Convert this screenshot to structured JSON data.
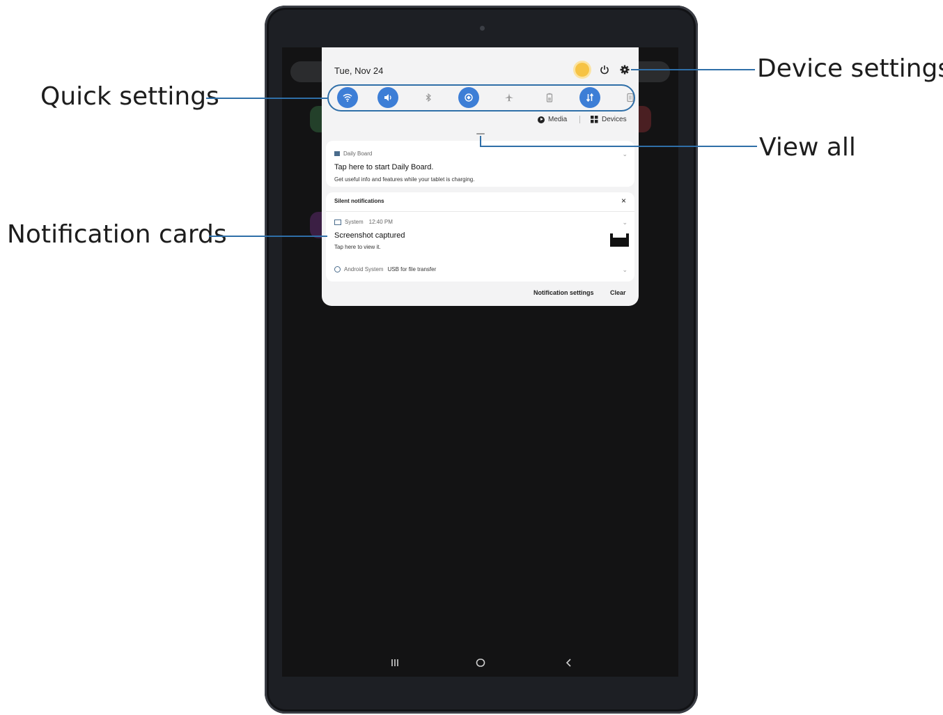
{
  "panel": {
    "date": "Tue, Nov 24",
    "media_label": "Media",
    "devices_label": "Devices",
    "daily_board": {
      "app": "Daily Board",
      "title": "Tap here to start Daily Board.",
      "body": "Get useful info and features while your tablet is charging."
    },
    "silent_header": "Silent notifications",
    "screenshot": {
      "app": "System",
      "time": "12:40 PM",
      "title": "Screenshot captured",
      "body": "Tap here to view it."
    },
    "usb": {
      "app": "Android System",
      "text": "USB for file transfer"
    },
    "notification_settings": "Notification settings",
    "clear": "Clear"
  },
  "quick_settings": [
    {
      "name": "wifi-icon",
      "on": true
    },
    {
      "name": "sound-icon",
      "on": true
    },
    {
      "name": "bluetooth-icon",
      "on": false
    },
    {
      "name": "auto-rotate-icon",
      "on": true
    },
    {
      "name": "airplane-icon",
      "on": false
    },
    {
      "name": "power-saving-icon",
      "on": false
    },
    {
      "name": "mobile-data-icon",
      "on": true
    },
    {
      "name": "portrait-icon",
      "on": false
    }
  ],
  "callouts": {
    "quick_settings": "Quick settings",
    "device_settings": "Device settings",
    "view_all": "View all",
    "notification_cards": "Notification cards"
  },
  "colors": {
    "accent": "#3d7ed6",
    "callout_line": "#2f6fa8"
  }
}
